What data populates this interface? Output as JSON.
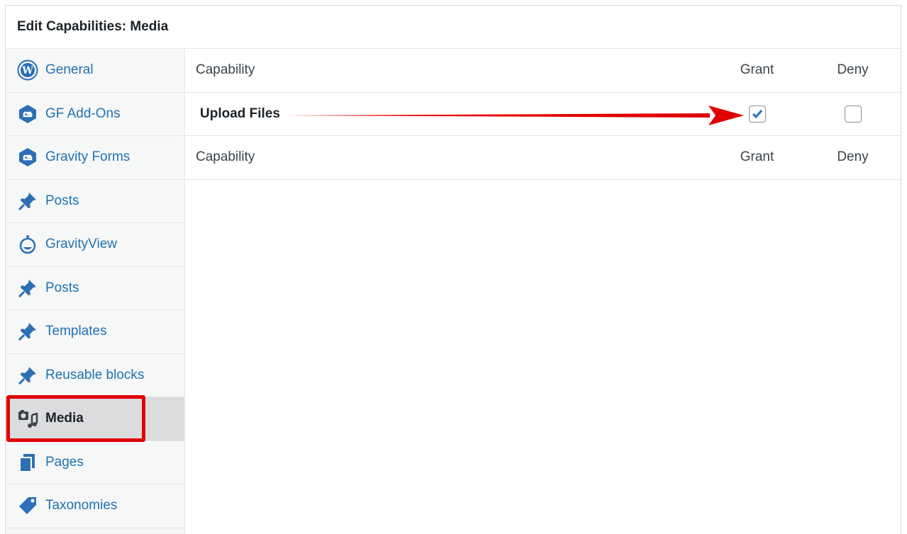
{
  "panel": {
    "title": "Edit Capabilities: Media"
  },
  "sidebar": {
    "items": [
      {
        "label": "General",
        "icon": "wordpress-icon"
      },
      {
        "label": "GF Add-Ons",
        "icon": "gravity-forms-icon"
      },
      {
        "label": "Gravity Forms",
        "icon": "gravity-forms-icon"
      },
      {
        "label": "Posts",
        "icon": "pushpin-icon"
      },
      {
        "label": "GravityView",
        "icon": "gravityview-icon"
      },
      {
        "label": "Posts",
        "icon": "pushpin-icon"
      },
      {
        "label": "Templates",
        "icon": "pushpin-icon"
      },
      {
        "label": "Reusable blocks",
        "icon": "pushpin-icon"
      },
      {
        "label": "Media",
        "icon": "media-icon",
        "active": true
      },
      {
        "label": "Pages",
        "icon": "pages-icon"
      },
      {
        "label": "Taxonomies",
        "icon": "tag-icon"
      }
    ]
  },
  "table": {
    "header": {
      "capability": "Capability",
      "grant": "Grant",
      "deny": "Deny"
    },
    "rows": [
      {
        "capability": "Upload Files",
        "grant": true,
        "deny": false
      }
    ],
    "footer": {
      "capability": "Capability",
      "grant": "Grant",
      "deny": "Deny"
    }
  },
  "colors": {
    "accent": "#2271b1",
    "highlight": "#e00000",
    "icon": "#2c6fb5"
  }
}
